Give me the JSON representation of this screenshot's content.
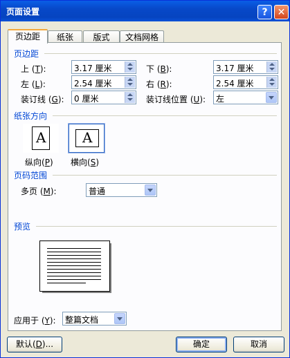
{
  "window": {
    "title": "页面设置",
    "help_glyph": "?",
    "close_glyph": "✕"
  },
  "tabs": [
    {
      "label": "页边距",
      "active": true
    },
    {
      "label": "纸张",
      "active": false
    },
    {
      "label": "版式",
      "active": false
    },
    {
      "label": "文档网格",
      "active": false
    }
  ],
  "margins": {
    "section": "页边距",
    "top": {
      "label": "上",
      "key": "T",
      "value": "3.17 厘米"
    },
    "bottom": {
      "label": "下",
      "key": "B",
      "value": "3.17 厘米"
    },
    "left": {
      "label": "左",
      "key": "L",
      "value": "2.54 厘米"
    },
    "right": {
      "label": "右",
      "key": "R",
      "value": "2.54 厘米"
    },
    "gutter": {
      "label": "装订线",
      "key": "G",
      "value": "0 厘米"
    },
    "gutter_pos": {
      "label": "装订线位置",
      "key": "U",
      "value": "左"
    }
  },
  "orientation": {
    "section": "纸张方向",
    "portrait": {
      "label": "纵向",
      "key": "P",
      "glyph": "A"
    },
    "landscape": {
      "label": "横向",
      "key": "S",
      "glyph": "A",
      "selected": true
    }
  },
  "pages": {
    "section": "页码范围",
    "multi": {
      "label": "多页",
      "key": "M",
      "value": "普通"
    }
  },
  "preview": {
    "section": "预览",
    "apply": {
      "label": "应用于",
      "key": "Y",
      "value": "整篇文档"
    }
  },
  "buttons": {
    "default": {
      "label": "默认",
      "key": "D",
      "suffix": "..."
    },
    "ok": "确定",
    "cancel": "取消"
  },
  "colors": {
    "title_bar": "#0a5ee6",
    "section_text": "#0046d5",
    "active_tab_accent": "#f4a83c"
  }
}
